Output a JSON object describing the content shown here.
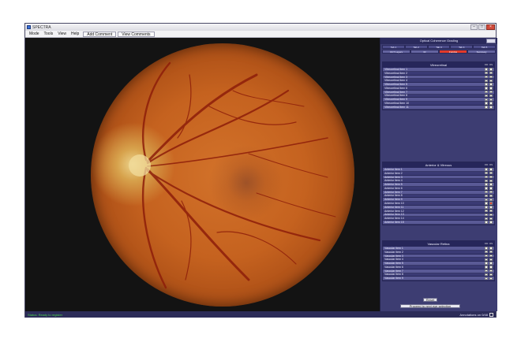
{
  "window": {
    "title": "SPECTRA"
  },
  "menu": {
    "items": [
      "Mode",
      "Tools",
      "View",
      "Help"
    ],
    "buttons": [
      "Add Comment",
      "View Comments"
    ]
  },
  "panel": {
    "title": "Optical Coherence Grading",
    "tabs_row1": [
      "Tab 1",
      "Tab 2",
      "Tab 3",
      "Tab 4",
      "Tab 5"
    ],
    "tabs_row2": [
      "OCT Layers",
      "IR",
      "Fundus",
      "Summary"
    ],
    "sections": [
      {
        "title": "Vitreoretinal",
        "col1": "OD",
        "col2": "OS",
        "rows": [
          "Vitreoretinal item 1",
          "Vitreoretinal item 2",
          "Vitreoretinal item 3",
          "Vitreoretinal item 4",
          "Vitreoretinal item 5",
          "Vitreoretinal item 6",
          "Vitreoretinal item 7",
          "Vitreoretinal item 8",
          "Vitreoretinal item 9",
          "Vitreoretinal item 10",
          "Vitreoretinal item 11"
        ]
      },
      {
        "title": "Anterior & Vitreous",
        "col1": "OD",
        "col2": "OS",
        "rows": [
          "Anterior item 1",
          "Anterior item 2",
          "Anterior item 3",
          "Anterior item 4",
          "Anterior item 5",
          "Anterior item 6",
          "Anterior item 7",
          "Anterior item 8",
          "Anterior item 9",
          "Anterior item 10",
          "Anterior item 11",
          "Anterior item 12",
          "Anterior item 13",
          "Anterior item 14",
          "Anterior item 15"
        ],
        "flagged_row": 9
      },
      {
        "title": "Vascular Retina",
        "col1": "OD",
        "col2": "OS",
        "rows": [
          "Vascular item 1",
          "Vascular item 2",
          "Vascular item 3",
          "Vascular item 4",
          "Vascular item 5",
          "Vascular item 6",
          "Vascular item 7",
          "Vascular item 8",
          "Vascular item 9"
        ]
      }
    ],
    "buttons": {
      "small": "Reset",
      "wide": "Proceed to next eye selection"
    }
  },
  "status": {
    "left": "Status: Ready to register",
    "right": "Annotations on 0/48"
  },
  "colors": {
    "accent": "#e23a2a",
    "panel_bg": "#3d3d72",
    "status_ok": "#4cd24c"
  }
}
